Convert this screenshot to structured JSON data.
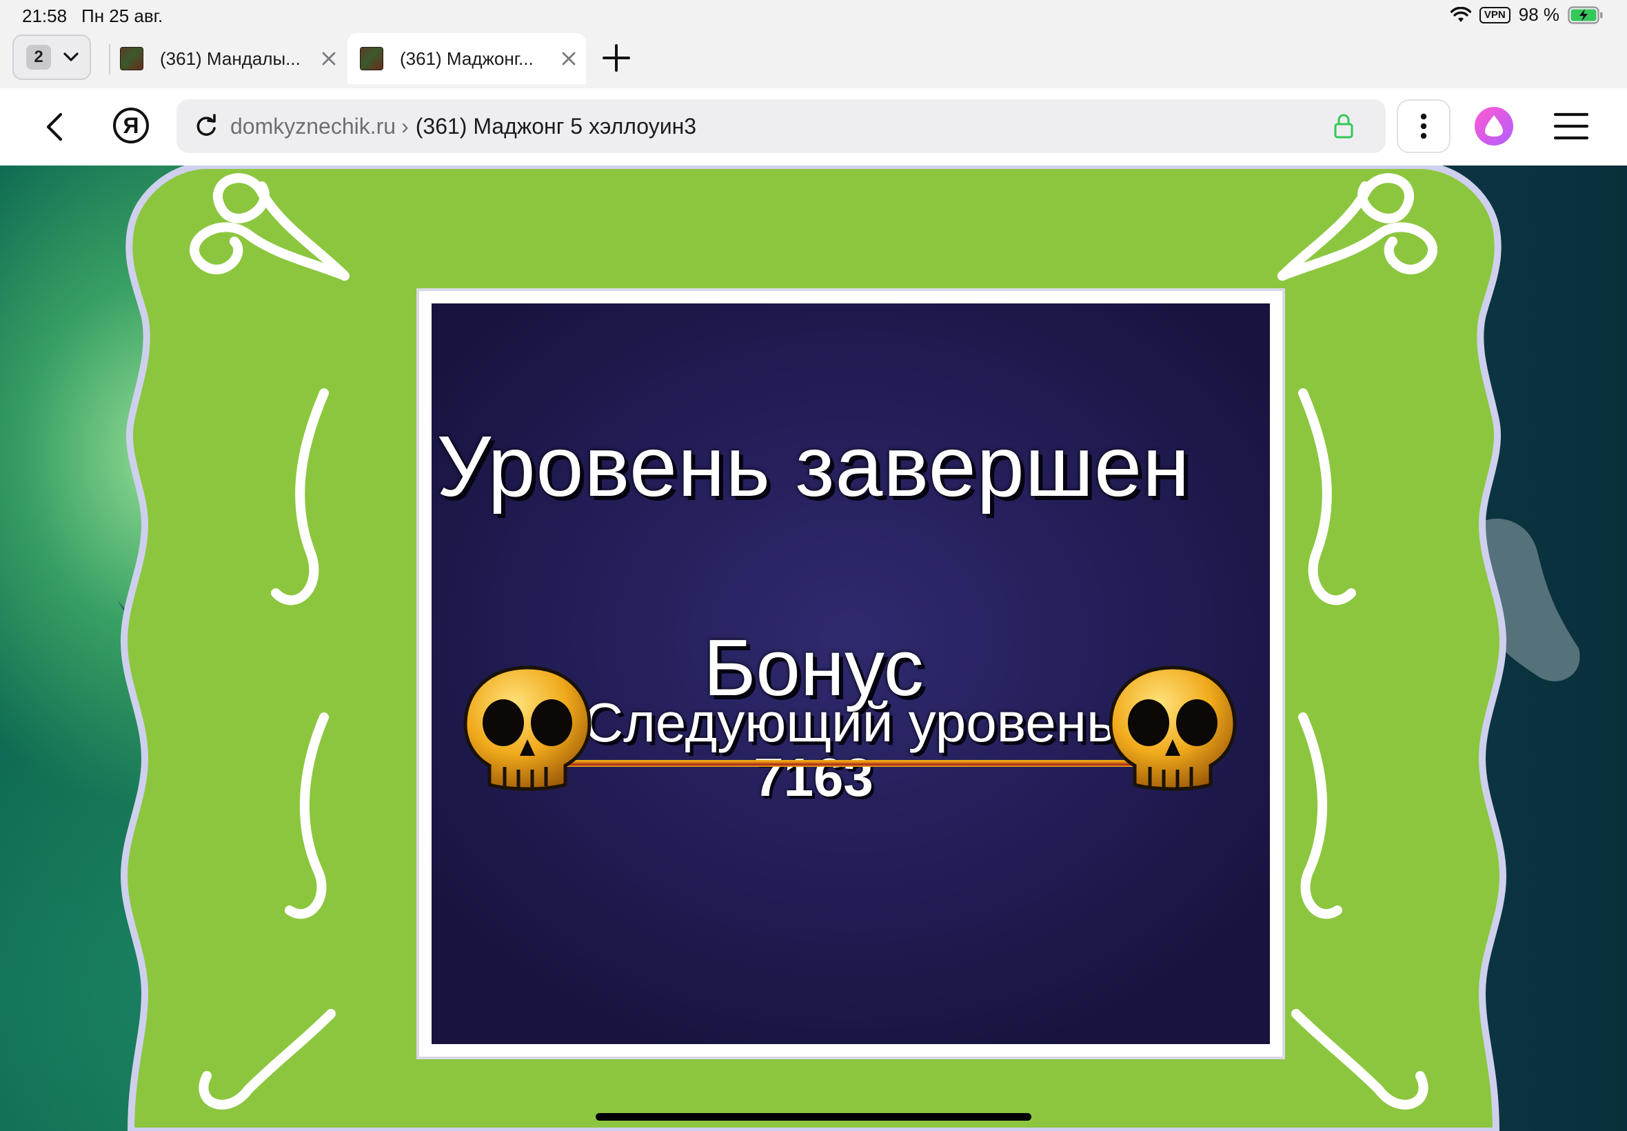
{
  "status_bar": {
    "time": "21:58",
    "date": "Пн 25 авг.",
    "vpn": "VPN",
    "battery": "98 %"
  },
  "tabs": {
    "count": "2",
    "items": [
      {
        "title": "(361) Мандалы...",
        "active": false
      },
      {
        "title": "(361) Маджонг...",
        "active": true
      }
    ]
  },
  "address_bar": {
    "yandex_letter": "Я",
    "domain": "domkyznechik.ru",
    "separator": "›",
    "page_title": "(361) Маджонг 5 хэллоуин3"
  },
  "game": {
    "title": "Уровень завершен",
    "bonus_label": "Бонус",
    "bonus_value": "7163",
    "next_button": "Следующий уровень"
  },
  "colors": {
    "frame_green": "#8cc63f",
    "dialog_navy": "#221d56",
    "alice_gradient": [
      "#ff5ad0",
      "#b15cff"
    ],
    "lock_green": "#34c759"
  }
}
